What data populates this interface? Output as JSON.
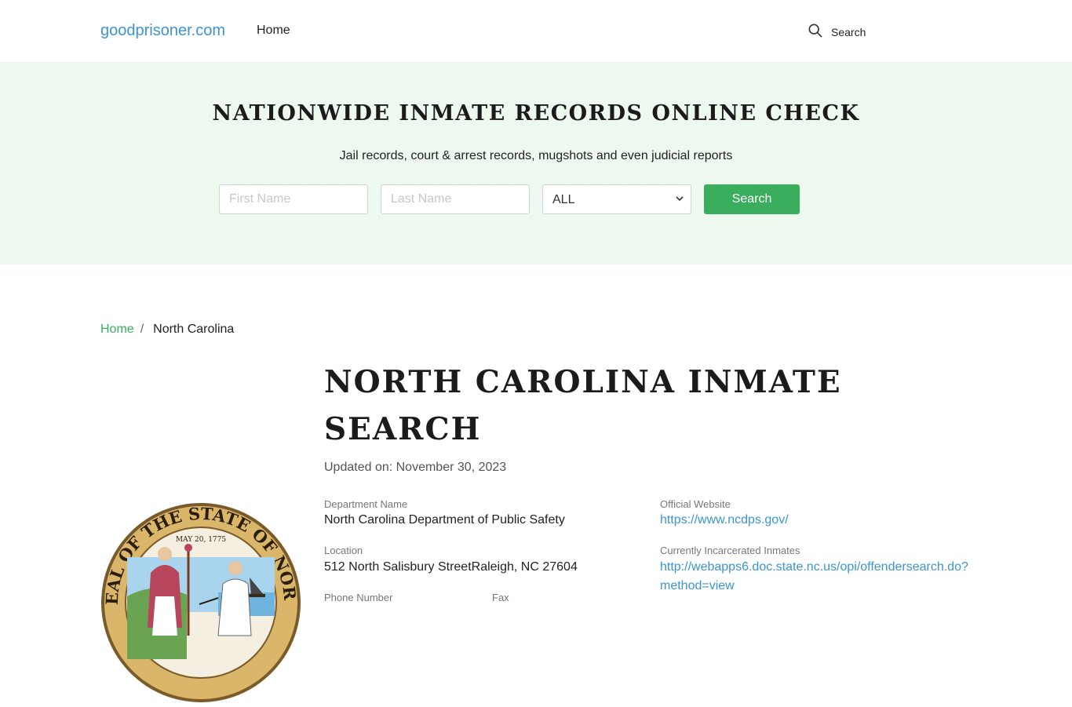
{
  "header": {
    "logo": "goodprisoner.com",
    "nav_home": "Home",
    "search_label": "Search"
  },
  "hero": {
    "title": "NATIONWIDE INMATE RECORDS ONLINE CHECK",
    "subtitle": "Jail records, court & arrest records, mugshots and even judicial reports",
    "first_name_placeholder": "First Name",
    "last_name_placeholder": "Last Name",
    "state_selected": "ALL",
    "search_button": "Search"
  },
  "breadcrumb": {
    "home": "Home",
    "separator": "/",
    "current": "North Carolina"
  },
  "main": {
    "title": "NORTH CAROLINA INMATE SEARCH",
    "updated": "Updated on: November 30, 2023",
    "department_label": "Department Name",
    "department_value": "North Carolina Department of Public Safety",
    "website_label": "Official Website",
    "website_value": "https://www.ncdps.gov/",
    "location_label": "Location",
    "location_value": "512 North Salisbury StreetRaleigh, NC 27604",
    "inmates_label": "Currently Incarcerated Inmates",
    "inmates_value": "http://webapps6.doc.state.nc.us/opi/offendersearch.do?method=view",
    "phone_label": "Phone Number",
    "fax_label": "Fax"
  },
  "seal": {
    "text_top": "AT SEAL OF THE STATE OF NORTH C",
    "date": "MAY 20, 1775"
  },
  "colors": {
    "brand_blue": "#3a95d2",
    "accent_green": "#3aae5c",
    "hero_bg": "#edf8ef"
  }
}
